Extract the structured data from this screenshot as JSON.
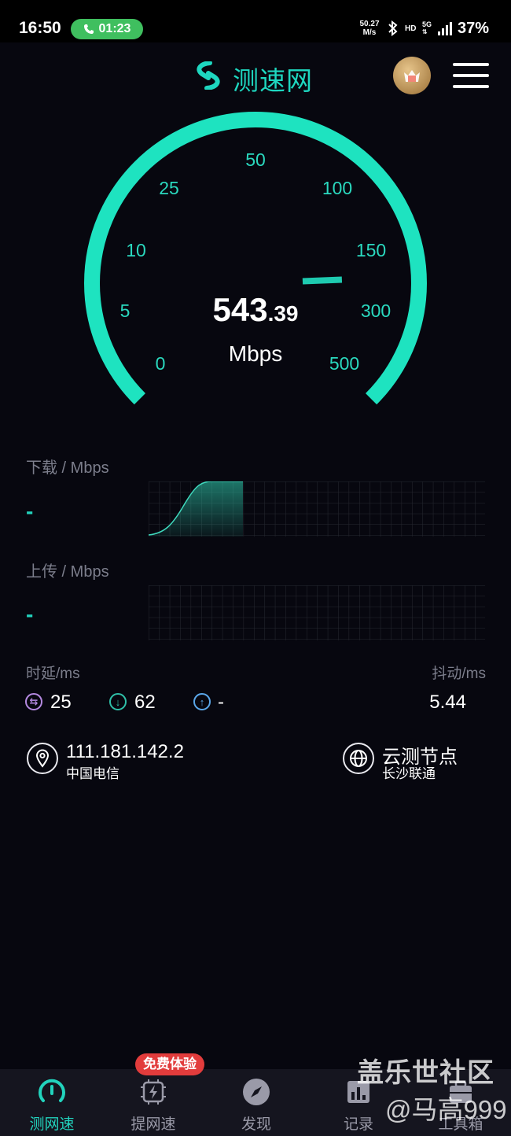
{
  "status_bar": {
    "time": "16:50",
    "call_timer": "01:23",
    "net_speed_value": "50.27",
    "net_speed_unit": "M/s",
    "hd": "HD",
    "network": "5G",
    "battery": "37%"
  },
  "header": {
    "app_title": "测速网",
    "logo_icon": "s-swirl-icon",
    "avatar_icon": "crown-avatar-icon",
    "menu_icon": "hamburger-menu-icon",
    "accent_color": "#1ed7c0"
  },
  "gauge": {
    "value_int": "543",
    "value_dec": ".39",
    "unit": "Mbps",
    "value": 543.39,
    "ticks": [
      "0",
      "5",
      "10",
      "25",
      "50",
      "100",
      "150",
      "300",
      "500"
    ]
  },
  "download": {
    "label": "下载 / Mbps",
    "value": "-"
  },
  "upload": {
    "label": "上传 / Mbps",
    "value": "-"
  },
  "latency": {
    "label": "时延/ms",
    "jitter_label": "抖动/ms",
    "idle": "25",
    "down": "62",
    "up": "-",
    "jitter": "5.44"
  },
  "info": {
    "ip": "111.181.142.2",
    "isp": "中国电信",
    "node": "云测节点",
    "node_location": "长沙联通"
  },
  "bottom_nav": {
    "items": [
      {
        "label": "测网速",
        "icon": "speedometer-icon"
      },
      {
        "label": "提网速",
        "icon": "chip-bolt-icon"
      },
      {
        "label": "发现",
        "icon": "compass-icon"
      },
      {
        "label": "记录",
        "icon": "records-icon"
      },
      {
        "label": "工具箱",
        "icon": "toolbox-icon"
      }
    ],
    "promo_badge": "免费体验"
  },
  "watermark": {
    "line1": "盖乐世社区",
    "line2": "@马高999"
  }
}
